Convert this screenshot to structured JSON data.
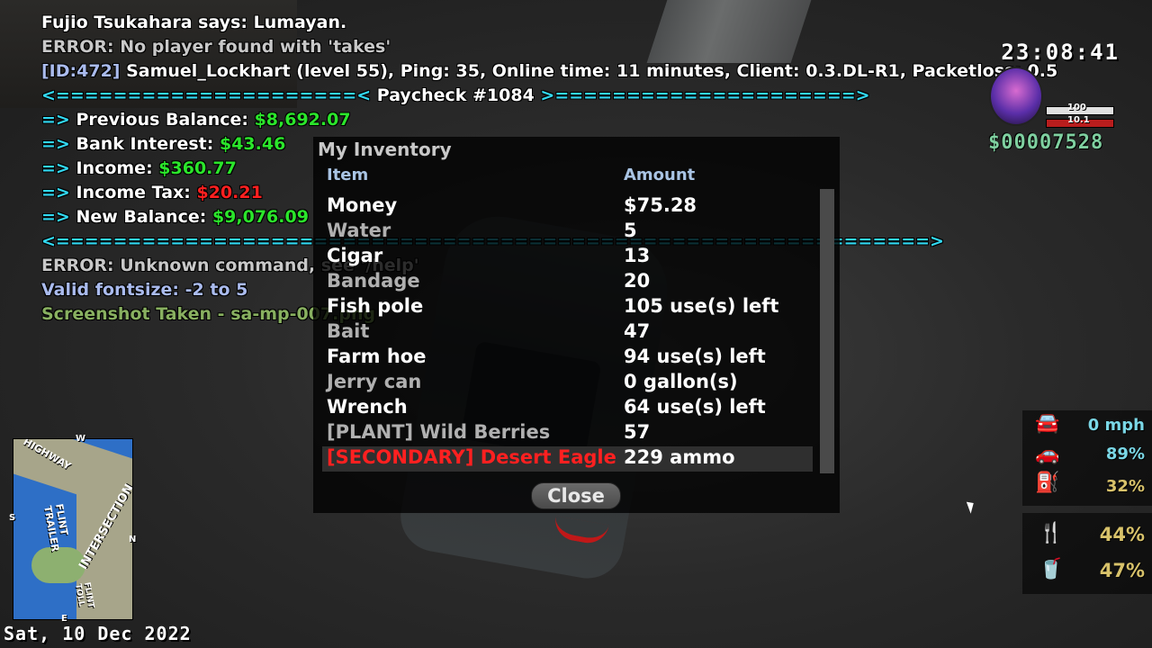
{
  "chat": [
    {
      "parts": [
        {
          "t": "Fujio Tsukahara says: Lumayan.",
          "c": "w"
        }
      ]
    },
    {
      "parts": [
        {
          "t": "ERROR: No player found with 'takes'",
          "c": "g"
        }
      ]
    },
    {
      "parts": [
        {
          "t": "[ID:472] ",
          "c": "lb"
        },
        {
          "t": "Samuel_Lockhart (level 55), Ping: 35, Online time: 11 minutes, Client: 0.3.DL-R1, Packetloss: 0.5",
          "c": "w"
        }
      ]
    },
    {
      "parts": [
        {
          "t": "<=====================< ",
          "c": "c"
        },
        {
          "t": "Paycheck #1084",
          "c": "w"
        },
        {
          "t": " >=====================>",
          "c": "c"
        }
      ]
    },
    {
      "parts": [
        {
          "t": "=> ",
          "c": "c"
        },
        {
          "t": "Previous Balance: ",
          "c": "w"
        },
        {
          "t": "$8,692.07",
          "c": "gr"
        }
      ]
    },
    {
      "parts": [
        {
          "t": "=> ",
          "c": "c"
        },
        {
          "t": "Bank Interest: ",
          "c": "w"
        },
        {
          "t": "$43.46",
          "c": "gr"
        }
      ]
    },
    {
      "parts": [
        {
          "t": "=> ",
          "c": "c"
        },
        {
          "t": "Income: ",
          "c": "w"
        },
        {
          "t": "$360.77",
          "c": "gr"
        }
      ]
    },
    {
      "parts": [
        {
          "t": "=> ",
          "c": "c"
        },
        {
          "t": "Income Tax: ",
          "c": "w"
        },
        {
          "t": "$20.21",
          "c": "r"
        }
      ]
    },
    {
      "parts": [
        {
          "t": "=> ",
          "c": "c"
        },
        {
          "t": "New Balance: ",
          "c": "w"
        },
        {
          "t": "$9,076.09",
          "c": "gr"
        }
      ]
    },
    {
      "parts": [
        {
          "t": "<=============================================================>",
          "c": "c"
        }
      ]
    },
    {
      "parts": [
        {
          "t": "ERROR: Unknown command, see '/help'",
          "c": "g"
        }
      ]
    },
    {
      "parts": [
        {
          "t": "Valid fontsize: -2 to 5",
          "c": "lb"
        }
      ]
    },
    {
      "parts": [
        {
          "t": "Screenshot Taken - sa-mp-007.png",
          "c": "ol"
        }
      ]
    }
  ],
  "hud": {
    "clock": "23:08:41",
    "health_label": "100",
    "armor_label": "10.1",
    "money": "$00007528",
    "date": "Sat, 10 Dec 2022"
  },
  "inventory": {
    "title": "My Inventory",
    "col_item": "Item",
    "col_amount": "Amount",
    "close_label": "Close",
    "items": [
      {
        "name": "Money",
        "amount": "$75.28",
        "style": "hi"
      },
      {
        "name": "Water",
        "amount": "5",
        "style": "dim"
      },
      {
        "name": "Cigar",
        "amount": "13",
        "style": "hi"
      },
      {
        "name": "Bandage",
        "amount": "20",
        "style": "dim"
      },
      {
        "name": "Fish pole",
        "amount": "105 use(s) left",
        "style": "hi"
      },
      {
        "name": "Bait",
        "amount": "47",
        "style": "dim"
      },
      {
        "name": "Farm hoe",
        "amount": "94 use(s) left",
        "style": "hi"
      },
      {
        "name": "Jerry can",
        "amount": "0 gallon(s)",
        "style": "dim"
      },
      {
        "name": "Wrench",
        "amount": "64 use(s) left",
        "style": "hi"
      },
      {
        "name": "[PLANT] Wild Berries",
        "amount": "57",
        "style": "dim"
      },
      {
        "name": "[SECONDARY] Desert Eagle",
        "amount": "229 ammo",
        "style": "sel"
      }
    ]
  },
  "minimap": {
    "labels": [
      "HIGHWAY",
      "FLINT TRAILER",
      "INTERSECTION",
      "FLINT TOLL"
    ],
    "compass": {
      "n": "N",
      "s": "S",
      "e": "E",
      "w": "W"
    }
  },
  "vehicle": {
    "speed": "0 mph",
    "health": "89%",
    "fuel": "32%",
    "speed_icon": "car-speed-icon",
    "health_icon": "car-icon",
    "fuel_icon": "fuel-icon"
  },
  "needs": {
    "hunger": "44%",
    "thirst": "47%",
    "hunger_icon": "food-icon",
    "thirst_icon": "drink-icon"
  },
  "colors": {
    "chat_cyan": "#32d9f2",
    "money_green": "#2be52b",
    "error_red": "#ff2020",
    "header_blue": "#a9c4e4",
    "stat_cyan": "#7ad7e6",
    "stat_gold": "#d8c26a"
  }
}
